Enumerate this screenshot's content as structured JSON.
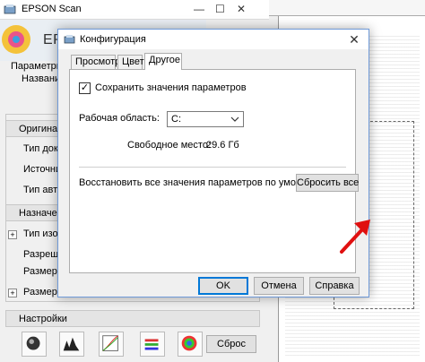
{
  "background_window": {
    "title": "EPSON Scan",
    "brand": "EPSON",
    "params_label": "Параметры",
    "name_label": "Название:",
    "original_section": "Оригинал",
    "doc_type_label": "Тип докуме",
    "source_label": "Источник до",
    "auto_type_label": "Тип автоэкс",
    "destination_section": "Назначение",
    "image_type_label": "Тип изобра",
    "resolution_label": "Разрешени",
    "doc_size_label": "Размер док",
    "target_size_label": "Размер на",
    "settings_section": "Настройки",
    "reset_button": "Сброс"
  },
  "dialog": {
    "title": "Конфигурация",
    "tabs": [
      {
        "label": "Просмотр",
        "active": false
      },
      {
        "label": "Цвет",
        "active": false
      },
      {
        "label": "Другое",
        "active": true
      }
    ],
    "save_settings_checkbox": {
      "label": "Сохранить значения параметров",
      "checked": true,
      "check_glyph": "✓"
    },
    "work_area_label": "Рабочая область:",
    "work_area_value": "C:",
    "free_space_label": "Свободное место:",
    "free_space_value": "29.6 Гб",
    "restore_text": "Восстановить все значения параметров по умолчанию.",
    "reset_all_button": "Сбросить все",
    "ok_button": "OK",
    "cancel_button": "Отмена",
    "help_button": "Справка",
    "close_glyph": "✕"
  },
  "colors": {
    "arrow": "#e01010",
    "accent_border": "#0078d7"
  }
}
